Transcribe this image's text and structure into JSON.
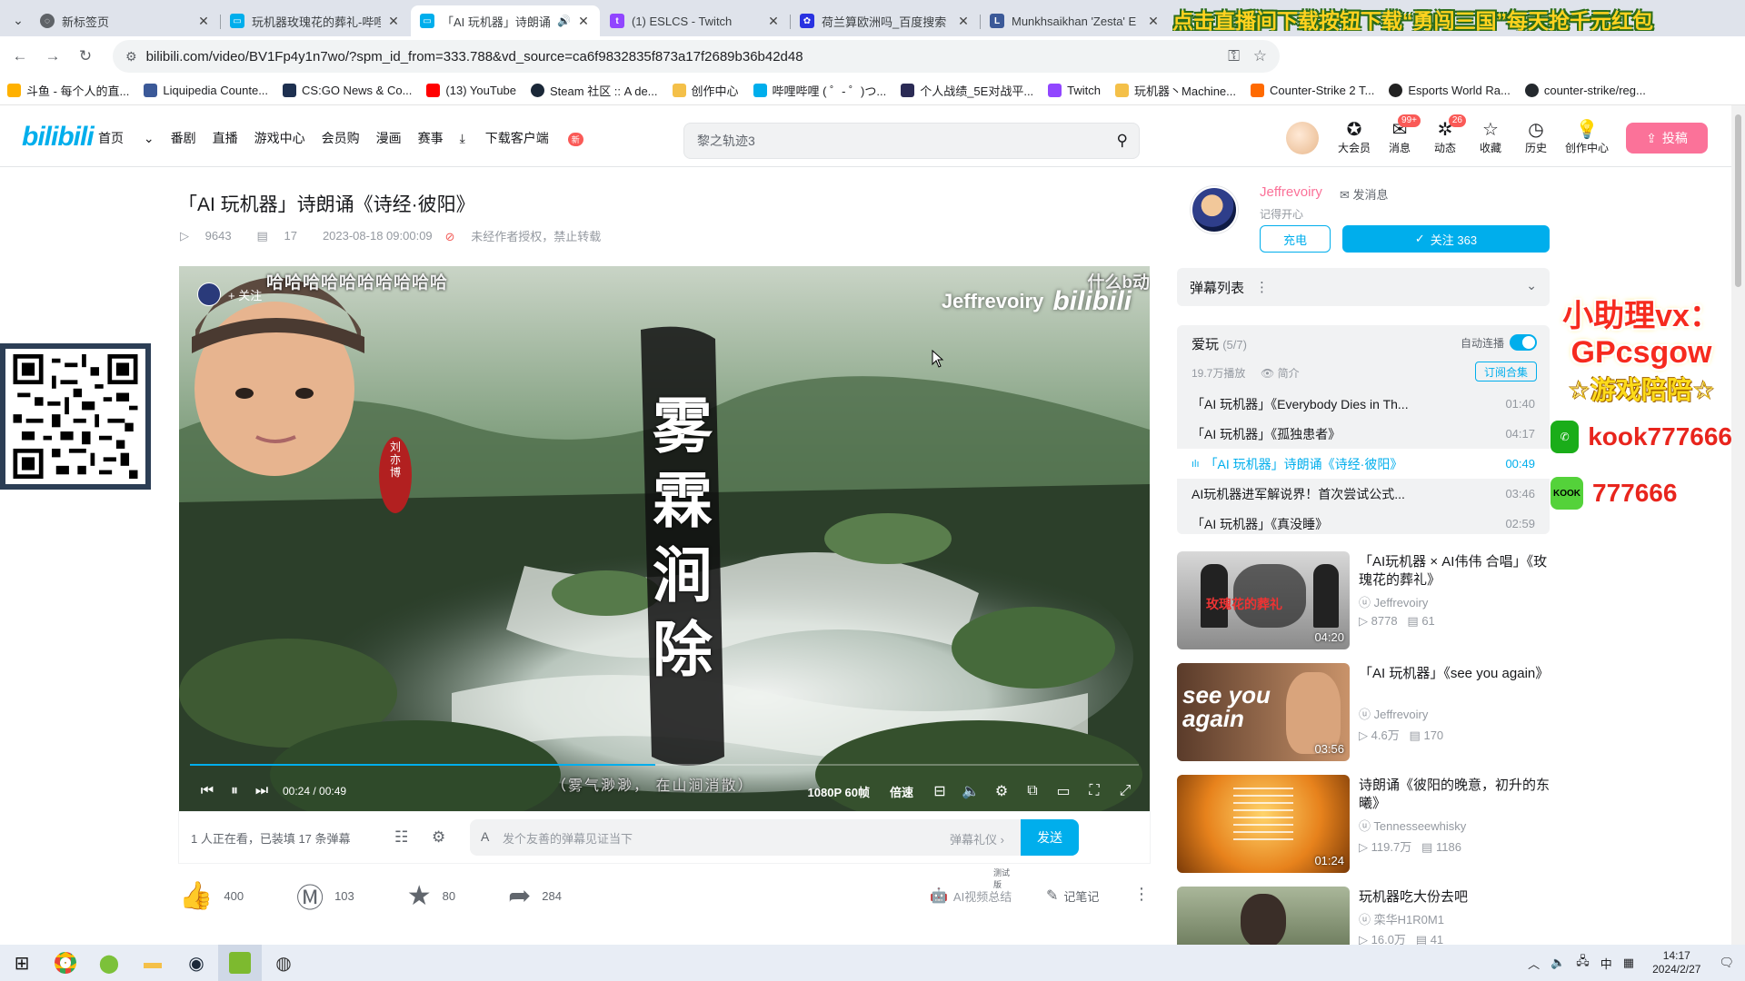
{
  "browser": {
    "tabs": [
      {
        "title": "新标签页",
        "icon": "chrome-newtab-icon",
        "active": false
      },
      {
        "title": "玩机器玫瑰花的葬礼-哔哩",
        "icon": "bilibili-tv-icon",
        "active": false
      },
      {
        "title": "「AI 玩机器」诗朗诵",
        "icon": "bilibili-tv-icon",
        "active": true,
        "audio": true
      },
      {
        "title": "(1) ESLCS - Twitch",
        "icon": "twitch-icon",
        "active": false
      },
      {
        "title": "荷兰算欧洲吗_百度搜索",
        "icon": "baidu-icon",
        "active": false
      },
      {
        "title": "Munkhsaikhan 'Zesta' E",
        "icon": "liquipedia-icon",
        "active": false
      }
    ],
    "tab_banner_ad": "点击直播间下载按钮下载“勇闯三国”每天抢千元红包",
    "url": "bilibili.com/video/BV1Fp4y1n7wo/?spm_id_from=333.788&vd_source=ca6f9832835f873a17f2689b36b42d48",
    "bookmarks": [
      "斗鱼 - 每个人的直...",
      "Liquipedia Counte...",
      "CS:GO News & Co...",
      "(13) YouTube",
      "Steam 社区 :: A de...",
      "创作中心",
      "哔哩哔哩 ( ゜- ゜)つ...",
      "个人战绩_5E对战平...",
      "Twitch",
      "玩机器丶Machine...",
      "Counter-Strike 2 T...",
      "Esports World Ra...",
      "counter-strike/reg..."
    ]
  },
  "bili_header": {
    "logo": "bilibili",
    "nav": [
      "首页",
      "番剧",
      "直播",
      "游戏中心",
      "会员购",
      "漫画",
      "赛事",
      "下载客户端"
    ],
    "download_badge": "新",
    "search_placeholder": "黎之轨迹3",
    "icons": [
      {
        "label": "大会员",
        "icon": "vip-icon",
        "badge": ""
      },
      {
        "label": "消息",
        "icon": "message-icon",
        "badge": "99+"
      },
      {
        "label": "动态",
        "icon": "dynamic-icon",
        "badge": "26"
      },
      {
        "label": "收藏",
        "icon": "star-icon",
        "badge": ""
      },
      {
        "label": "历史",
        "icon": "history-icon",
        "badge": ""
      },
      {
        "label": "创作中心",
        "icon": "bulb-icon",
        "badge": ""
      }
    ],
    "upload_label": "投稿"
  },
  "video": {
    "title": "「AI 玩机器」诗朗诵《诗经·彼阳》",
    "views": "9643",
    "danmaku_count": "17",
    "date": "2023-08-18 09:00:09",
    "copyright": "未经作者授权，禁止转载"
  },
  "player": {
    "follow_label": "+ 关注",
    "danmaku_scroll_1": "哈哈哈哈哈哈哈哈哈哈",
    "danmaku_scroll_2": "什么b动",
    "watermark_name": "Jeffrevoiry",
    "watermark_logo": "bilibili",
    "calligraphy": "雾霖涧除",
    "seal_text": "刘亦博",
    "subtitle": "（雾气渺渺，  在山涧消散）",
    "current_time": "00:24",
    "total_time": "00:49",
    "progress": 0.49,
    "quality": "1080P 60帧",
    "speed": "倍速"
  },
  "danmaku_bar": {
    "info": "1 人正在看，已装填 17 条弹幕",
    "placeholder": "发个友善的弹幕见证当下",
    "etiquette": "弹幕礼仪 ›",
    "send": "发送"
  },
  "actions": {
    "like": "400",
    "coin": "103",
    "fav": "80",
    "share": "284",
    "ai_summary": "AI视频总结",
    "ai_badge": "测试版",
    "note": "记笔记"
  },
  "uploader": {
    "name": "Jeffrevoiry",
    "message": "发消息",
    "sign": "记得开心",
    "charge": "充电",
    "follow": "关注 363"
  },
  "danmaku_list": {
    "label": "弹幕列表"
  },
  "playlist": {
    "name": "爱玩",
    "progress": "(5/7)",
    "autoplay": "自动连播",
    "plays": "19.7万播放",
    "intro": "简介",
    "subscribe": "订阅合集",
    "items": [
      {
        "title": "「AI 玩机器」《Everybody Dies in Th...",
        "duration": "01:40",
        "current": false
      },
      {
        "title": "「AI 玩机器」《孤独患者》",
        "duration": "04:17",
        "current": false
      },
      {
        "title": "「AI 玩机器」诗朗诵《诗经·彼阳》",
        "duration": "00:49",
        "current": true
      },
      {
        "title": "AI玩机器进军解说界！首次尝试公式...",
        "duration": "03:46",
        "current": false
      },
      {
        "title": "「AI 玩机器」《真没睡》",
        "duration": "02:59",
        "current": false
      }
    ]
  },
  "recommendations": [
    {
      "title": "「AI玩机器 × AI伟伟 合唱」《玫瑰花的葬礼》",
      "author": "Jeffrevoiry",
      "views": "8778",
      "danmaku": "61",
      "duration": "04:20",
      "thumb_text": "玫瑰花的葬礼"
    },
    {
      "title": "「AI 玩机器」《see you again》",
      "author": "Jeffrevoiry",
      "views": "4.6万",
      "danmaku": "170",
      "duration": "03:56",
      "thumb_text": "see you again"
    },
    {
      "title": "诗朗诵《彼阳的晚意，初升的东曦》",
      "author": "Tennesseewhisky",
      "views": "119.7万",
      "danmaku": "1186",
      "duration": "01:24",
      "thumb_text": ""
    },
    {
      "title": "玩机器吃大份去吧",
      "author": "栾华H1R0M1",
      "views": "16.0万",
      "danmaku": "41",
      "duration": "",
      "thumb_text": ""
    }
  ],
  "side_ad": {
    "line1": "小助理vx：",
    "line2": "GPcsgow",
    "line3": "游戏陪陪",
    "wechat": "kook777666",
    "kook": "777666",
    "kook_logo": "KOOK"
  },
  "taskbar": {
    "ime": "中",
    "time": "14:17",
    "date": "2024/2/27"
  }
}
